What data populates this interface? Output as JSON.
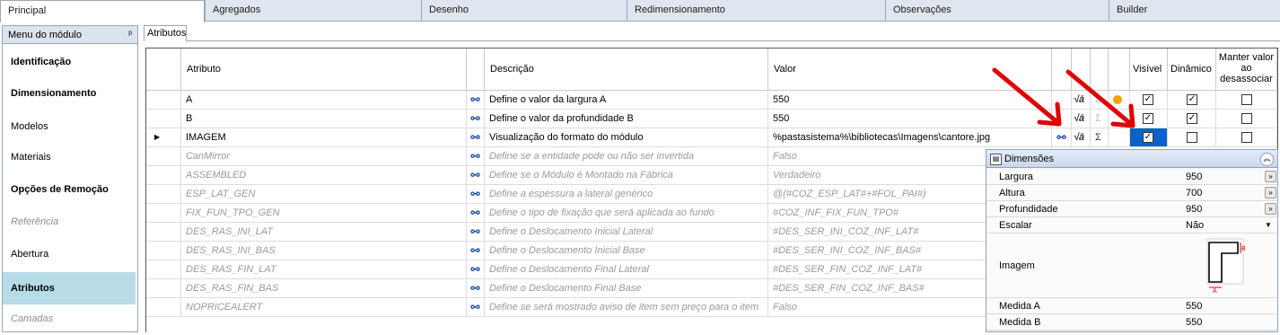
{
  "tabs": [
    "Principal",
    "Agregados",
    "Desenho",
    "Redimensionamento",
    "Observações",
    "Builder"
  ],
  "menu": {
    "title": "Menu do módulo",
    "items": [
      {
        "label": "Identificação",
        "style": "bold"
      },
      {
        "label": "Dimensionamento",
        "style": "bold"
      },
      {
        "label": "Modelos",
        "style": "normal"
      },
      {
        "label": "Materiais",
        "style": "normal"
      },
      {
        "label": "Opções de Remoção",
        "style": "bold"
      },
      {
        "label": "Referência",
        "style": "disabled"
      },
      {
        "label": "Abertura",
        "style": "normal"
      },
      {
        "label": "Atributos",
        "style": "selected"
      },
      {
        "label": "Camadas",
        "style": "disabled"
      }
    ]
  },
  "subtab": "Atributos",
  "grid": {
    "headers": {
      "atributo": "Atributo",
      "descricao": "Descrição",
      "valor": "Valor",
      "visivel": "Visível",
      "dinamico": "Dinâmico",
      "manter": "Manter valor ao desassociar"
    },
    "rows": [
      {
        "attr": "A",
        "desc": "Define o valor da largura A",
        "val": "550",
        "dim": false
      },
      {
        "attr": "B",
        "desc": "Define o valor da profundidade B",
        "val": "550",
        "dim": false
      },
      {
        "attr": "IMAGEM",
        "desc": "Visualização do formato do módulo",
        "val": "%pastasistema%\\bibliotecas\\Imagens\\cantore.jpg",
        "dim": false
      },
      {
        "attr": "CanMirror",
        "desc": "Define se a entidade pode ou não ser invertida",
        "val": "Falso",
        "dim": true
      },
      {
        "attr": "ASSEMBLED",
        "desc": "Define se o Módulo é Montado na Fábrica",
        "val": "Verdadeiro",
        "dim": true
      },
      {
        "attr": "ESP_LAT_GEN",
        "desc": "Define a espessura a lateral genérico",
        "val": "@(#COZ_ESP_LAT#+#FOL_PAI#)",
        "dim": true
      },
      {
        "attr": "FIX_FUN_TPO_GEN",
        "desc": "Define o tipo de fixação que será aplicada ao fundo",
        "val": "#COZ_INF_FIX_FUN_TPO#",
        "dim": true
      },
      {
        "attr": "DES_RAS_INI_LAT",
        "desc": "Define o Deslocamento Inicial Lateral",
        "val": "#DES_SER_INI_COZ_INF_LAT#",
        "dim": true
      },
      {
        "attr": "DES_RAS_INI_BAS",
        "desc": "Define o Deslocamento Inicial Base",
        "val": "#DES_SER_INI_COZ_INF_BAS#",
        "dim": true
      },
      {
        "attr": "DES_RAS_FIN_LAT",
        "desc": "Define o Deslocamento Final Lateral",
        "val": "#DES_SER_FIN_COZ_INF_LAT#",
        "dim": true
      },
      {
        "attr": "DES_RAS_FIN_BAS",
        "desc": "Define o Deslocamento Final Base",
        "val": "#DES_SER_FIN_COZ_INF_BAS#",
        "dim": true
      },
      {
        "attr": "NOPRICEALERT",
        "desc": "Define se será mostrado aviso de item sem preço para o item",
        "val": "Falso",
        "dim": true
      }
    ]
  },
  "panel": {
    "title": "Dimensões",
    "rows": [
      {
        "label": "Largura",
        "value": "950"
      },
      {
        "label": "Altura",
        "value": "700"
      },
      {
        "label": "Profundidade",
        "value": "950"
      },
      {
        "label": "Escalar",
        "value": "Não"
      },
      {
        "label": "Imagem",
        "value": ""
      },
      {
        "label": "Medida A",
        "value": "550"
      },
      {
        "label": "Medida B",
        "value": "550"
      }
    ],
    "image_labels": {
      "a": "A",
      "b": "B"
    }
  },
  "glyphs": {
    "binoculars": "👓",
    "sigma": "Σ",
    "sqrt": "√a",
    "check": "✓",
    "expand": "»",
    "collapse": "«"
  },
  "colors": {
    "selected_menu": "#b7dce7",
    "red_arrow": "#e00000",
    "selected_cell": "#0a62c9"
  }
}
